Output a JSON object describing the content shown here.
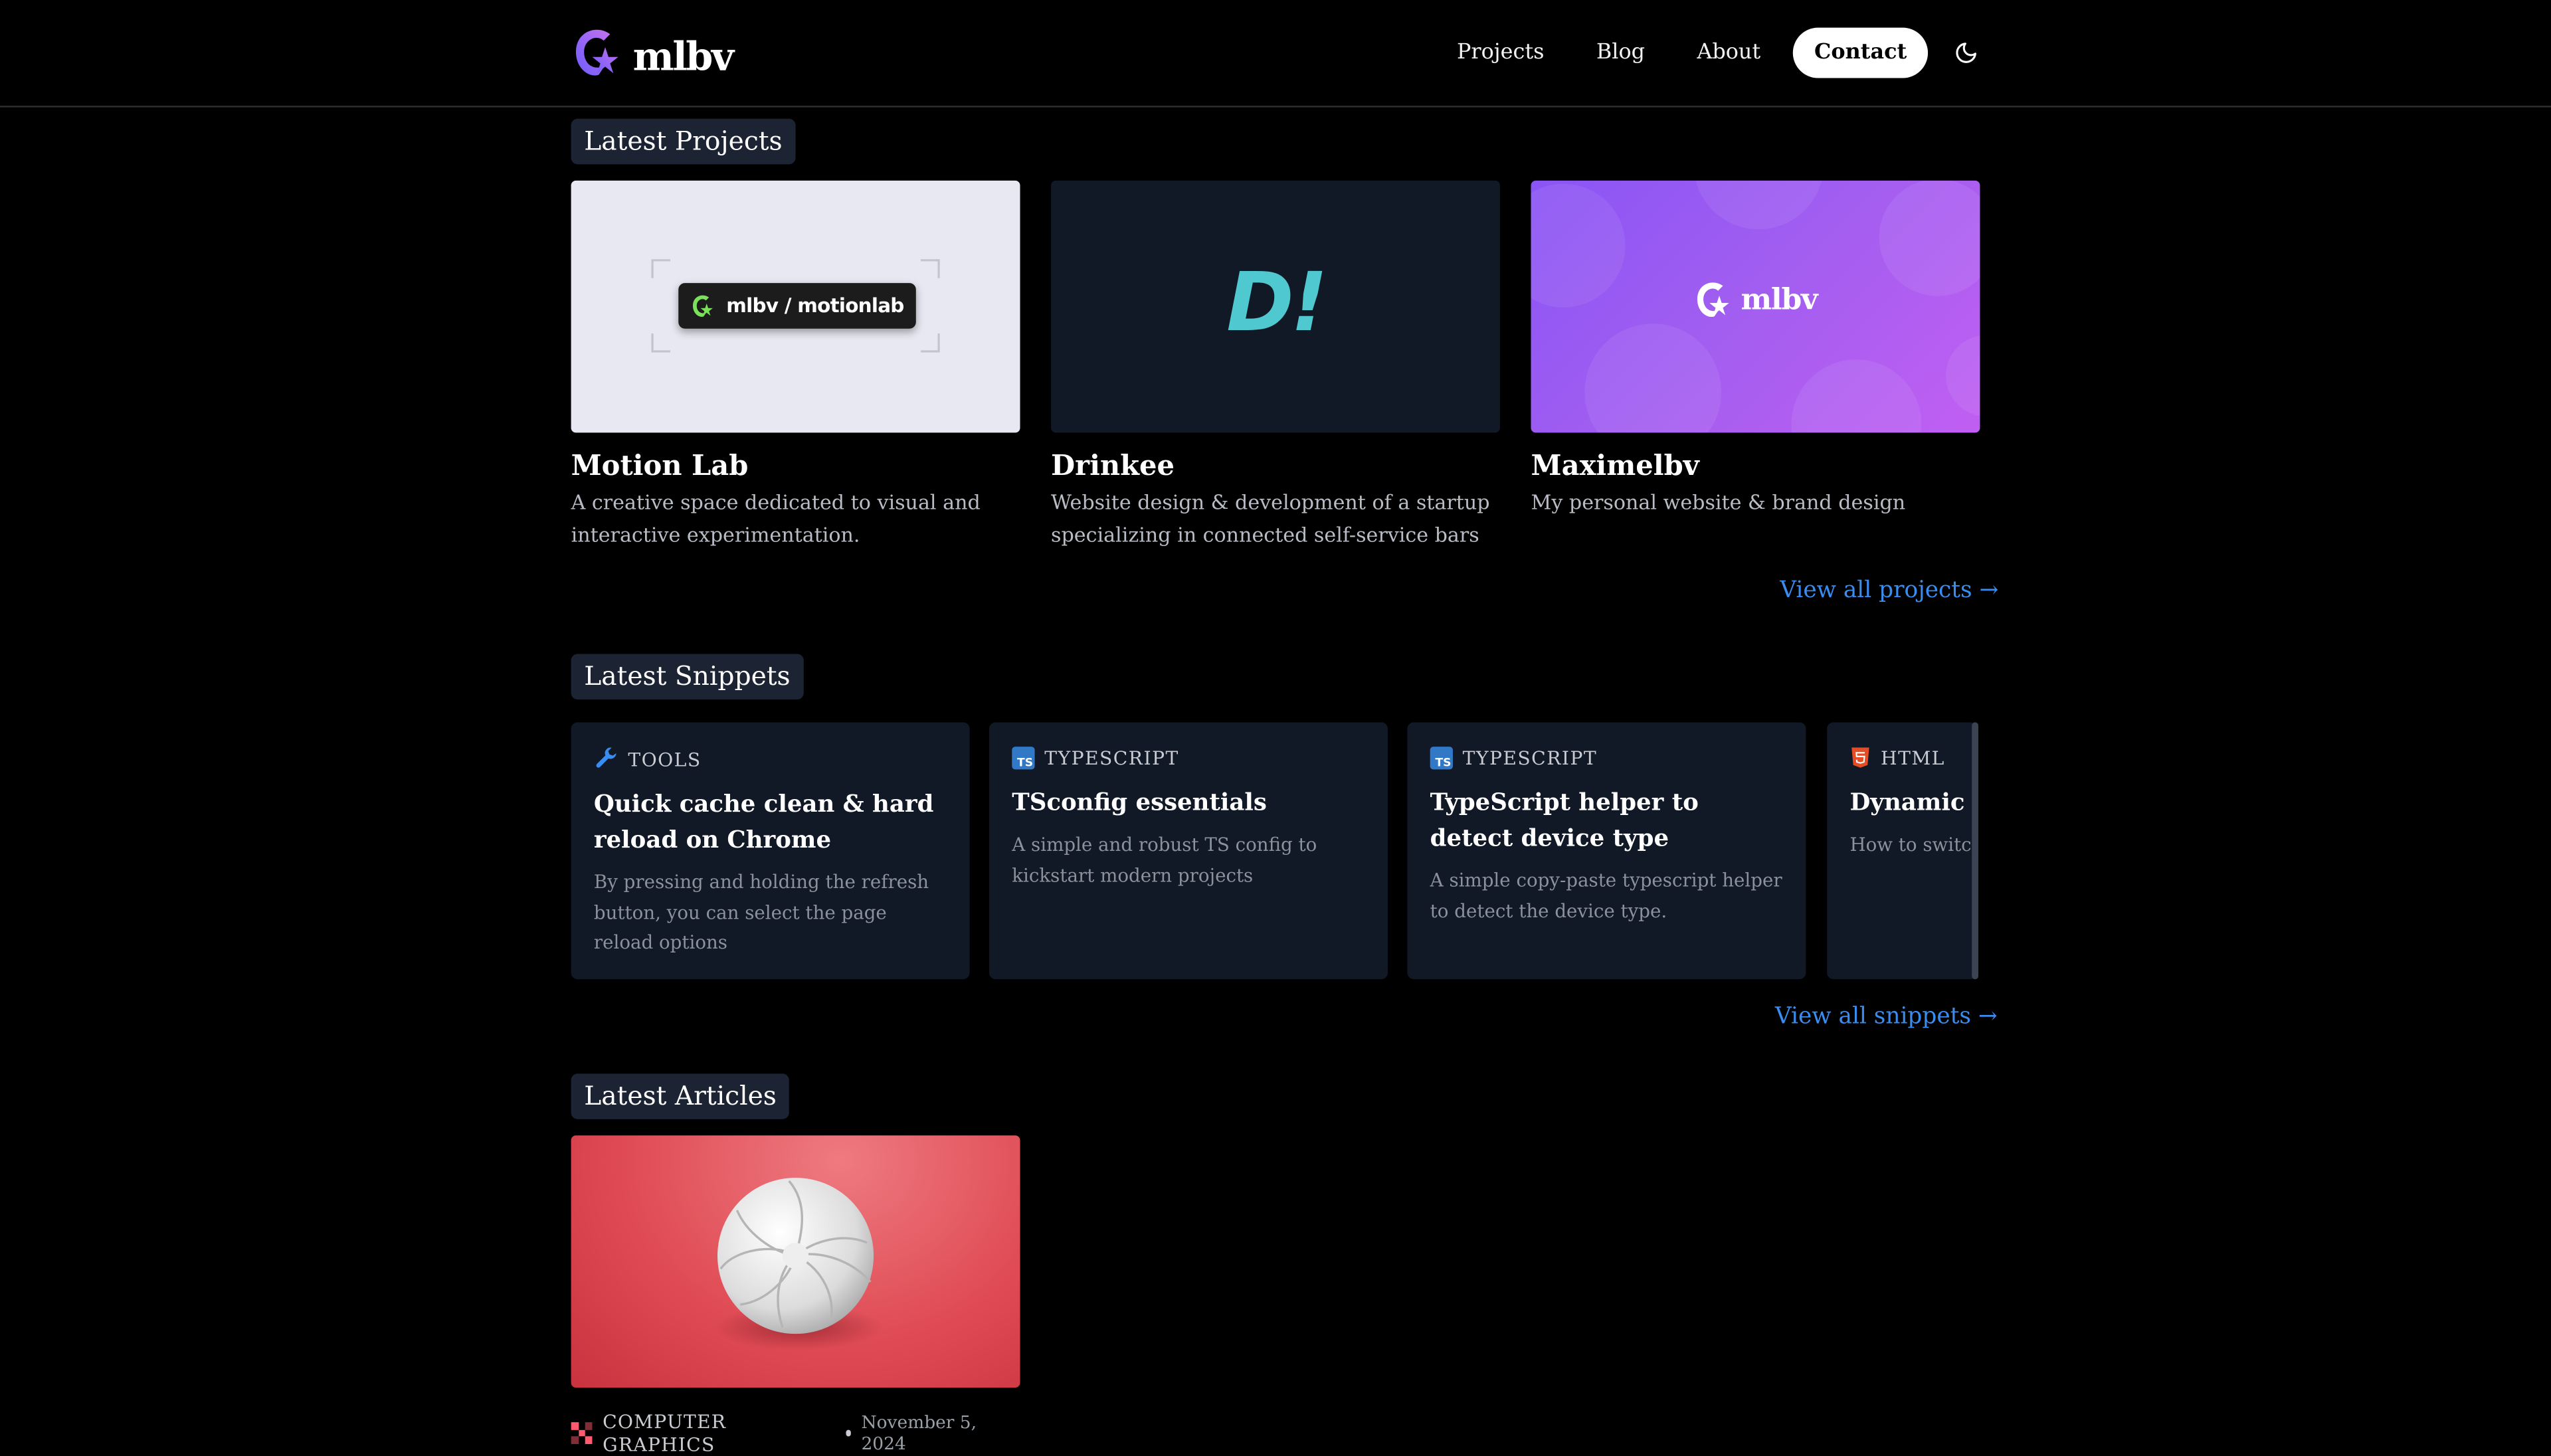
{
  "header": {
    "logo_text": "mlbv",
    "nav": [
      "Projects",
      "Blog",
      "About"
    ],
    "contact_label": "Contact"
  },
  "projects": {
    "section_label": "Latest Projects",
    "items": [
      {
        "title": "Motion Lab",
        "desc": "A creative space dedicated to visual and interactive experimentation.",
        "badge": "mlbv / motionlab"
      },
      {
        "title": "Drinkee",
        "desc": "Website design & development of a startup specializing in connected self-service bars",
        "logo": "D!"
      },
      {
        "title": "Maximelbv",
        "desc": "My personal website & brand design",
        "logo": "mlbv"
      }
    ],
    "view_all": "View all projects →"
  },
  "snippets": {
    "section_label": "Latest Snippets",
    "items": [
      {
        "tag": "TOOLS",
        "icon": "wrench-icon",
        "title": "Quick cache clean & hard reload on Chrome",
        "desc": "By pressing and holding the refresh button, you can select the page reload options"
      },
      {
        "tag": "TYPESCRIPT",
        "icon": "typescript-icon",
        "icon_text": "TS",
        "title": "TSconfig essentials",
        "desc": "A simple and robust TS config to kickstart modern projects"
      },
      {
        "tag": "TYPESCRIPT",
        "icon": "typescript-icon",
        "icon_text": "TS",
        "title": "TypeScript helper to detect device type",
        "desc": "A simple copy-paste typescript helper to detect the device type."
      },
      {
        "tag": "HTML",
        "icon": "html5-icon",
        "title": "Dynamic Fa Theme",
        "desc": "How to switcl based on light"
      }
    ],
    "view_all": "View all snippets →"
  },
  "articles": {
    "section_label": "Latest Articles",
    "items": [
      {
        "category": "COMPUTER GRAPHICS",
        "date": "November 5, 2024",
        "icon": "computer-graphics-icon"
      }
    ]
  },
  "colors": {
    "accent": "#3a8df0",
    "logo_gradient": [
      "#7a5cff",
      "#c471ed"
    ],
    "drinkee": "#4fc8d0",
    "ts_blue": "#3178c6",
    "html_red": "#e44d26"
  }
}
